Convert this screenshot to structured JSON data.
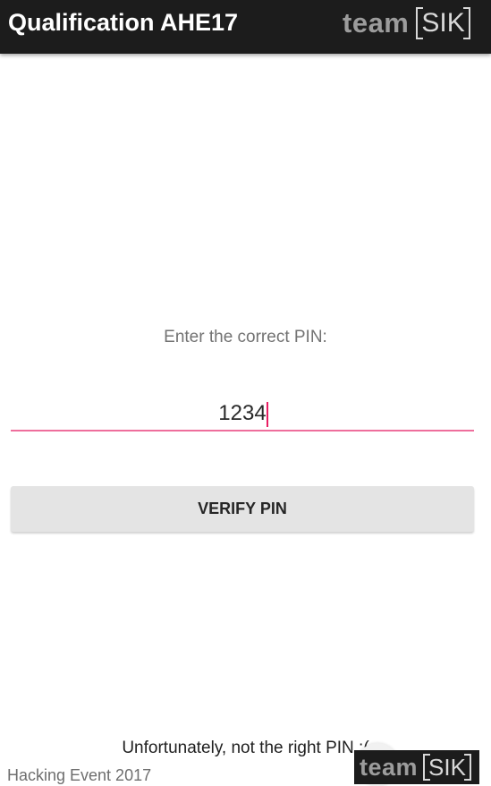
{
  "app_bar": {
    "title": "Qualification AHE17",
    "logo_word": "team",
    "logo_mark": "SIK"
  },
  "pin_form": {
    "prompt": "Enter the correct PIN:",
    "pin_value": "1234",
    "verify_label": "VERIFY PIN",
    "accent_color": "#e91e63"
  },
  "result_message": "Unfortunately, not the right PIN :(",
  "footer": {
    "event_text": "Hacking Event 2017",
    "logo_word": "team",
    "logo_mark": "SIK"
  }
}
